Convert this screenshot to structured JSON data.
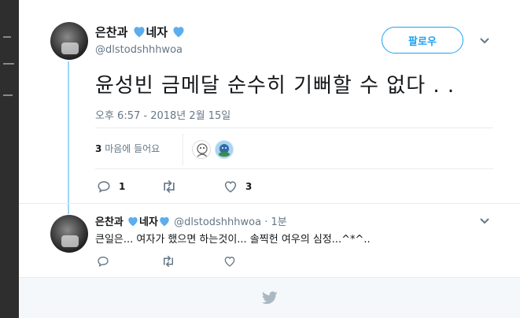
{
  "tweet": {
    "author_name": "은찬과",
    "author_suffix": "네자",
    "handle": "@dlstodshhhwoa",
    "follow_label": "팔로우",
    "text": "윤성빈 금메달 순수히 기뻐할 수 없다 . .",
    "timestamp": "오후 6:57 - 2018년 2월 15일",
    "likes_count": "3",
    "likes_label": "마음에 들어요",
    "actions": {
      "reply_count": "1",
      "retweet_count": "",
      "like_count": "3"
    }
  },
  "reply": {
    "author_name": "은찬과",
    "author_suffix": "네자",
    "handle": "@dlstodshhhwoa",
    "time": "· 1분",
    "text": "큰일은... 여자가 했으면 하는것이... 솔찍헌 여우의 심정...^*^.."
  },
  "icons": {
    "heart_emoji": "blue-heart-icon",
    "chevron": "chevron-down-icon",
    "reply": "reply-icon",
    "retweet": "retweet-icon",
    "like": "like-icon",
    "brand": "twitter-bird-icon"
  },
  "colors": {
    "accent": "#1da1f2",
    "heart": "#5dadec",
    "muted": "#657786",
    "thread_line": "#9ed4f7",
    "footer_bg": "#f5f8fa"
  }
}
